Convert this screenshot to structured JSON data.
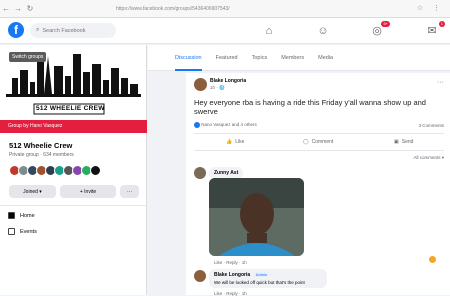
{
  "browser": {
    "url": "https://www.facebook.com/groups/5436406907543/",
    "tab_icons": "☆ ⋮"
  },
  "header": {
    "logo": "f",
    "search_placeholder": "Search Facebook",
    "icons": [
      "home-icon",
      "groups-icon",
      "notifications-icon",
      "messenger-icon"
    ],
    "badges": [
      "5+",
      "1"
    ]
  },
  "sidebar": {
    "cover_tag": "Switch groups",
    "cover_text": "512 WHEELIE CREW",
    "banner": "Group by Hano Vasquez",
    "group_name": "512 Wheelie Crew",
    "group_meta": "Private group · 634 members",
    "joined_label": "Joined ▾",
    "invite_label": "+ Invite",
    "more_label": "···",
    "links": [
      "Home",
      "Events"
    ]
  },
  "tabs": [
    "Discussion",
    "Featured",
    "Topics",
    "Members",
    "Media"
  ],
  "post": {
    "author": "Blake Longoria",
    "meta": "1h · 🌐",
    "text": "Hey everyone rba is having a ride this Friday y'all wanna show up and swerve",
    "reactions": "Nano Vasquez and 4 others",
    "comment_count": "3 Comments",
    "actions": [
      "Like",
      "Comment",
      "Send"
    ],
    "sort": "All comments ▾",
    "comment1_author": "Zunny Ast",
    "comment1_actions": "Like · Reply · 1h",
    "comment2_author": "Blake Longoria",
    "comment2_badge": "Admin",
    "comment2_text": "We will be looked off quick but that's the point",
    "comment2_actions": "Like · Reply · 1h"
  }
}
